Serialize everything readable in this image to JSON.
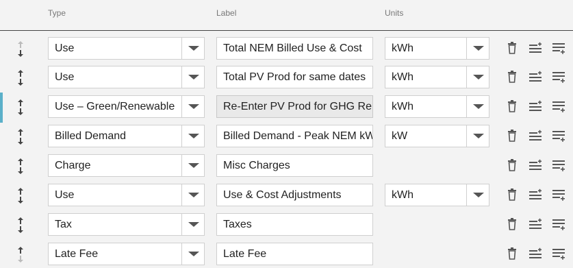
{
  "header": {
    "type": "Type",
    "label": "Label",
    "units": "Units"
  },
  "rows": [
    {
      "type": "Use",
      "label": "Total NEM Billed Use & Cost",
      "units": "kWh"
    },
    {
      "type": "Use",
      "label": "Total PV Prod for same dates",
      "units": "kWh"
    },
    {
      "type": "Use – Green/Renewable",
      "label": "Re-Enter PV Prod for GHG Reporting",
      "units": "kWh"
    },
    {
      "type": "Billed Demand",
      "label": "Billed Demand - Peak NEM kW",
      "units": "kW"
    },
    {
      "type": "Charge",
      "label": "Misc Charges",
      "units": ""
    },
    {
      "type": "Use",
      "label": "Use & Cost Adjustments",
      "units": "kWh"
    },
    {
      "type": "Tax",
      "label": "Taxes",
      "units": ""
    },
    {
      "type": "Late Fee",
      "label": "Late Fee",
      "units": ""
    }
  ]
}
